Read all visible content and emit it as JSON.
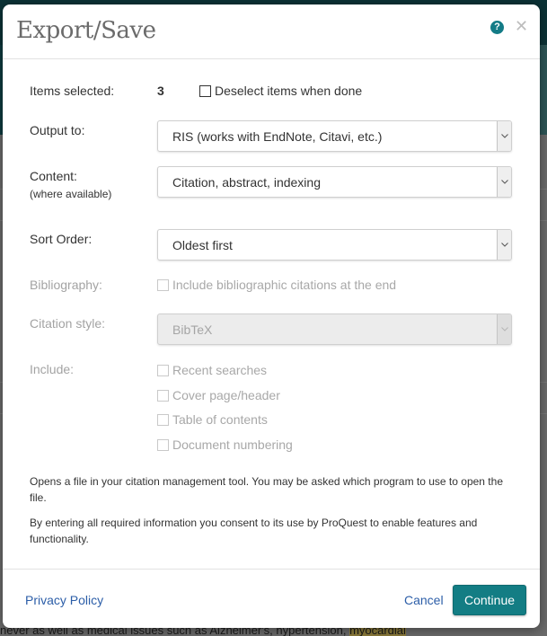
{
  "background": {
    "visible_text_prefix": "never as well as medical issues such as Alzheimer's, hypertension, ",
    "visible_text_highlight": "myocardial"
  },
  "dialog": {
    "title": "Export/Save",
    "help_icon": "question-circle-icon",
    "close_icon": "close-x-icon"
  },
  "form": {
    "items_selected": {
      "label": "Items selected:",
      "count": "3",
      "deselect_label": "Deselect items when done",
      "deselect_checked": false
    },
    "output_to": {
      "label": "Output to:",
      "selected": "RIS (works with EndNote, Citavi, etc.)"
    },
    "content": {
      "label": "Content:",
      "sublabel": "(where available)",
      "selected": "Citation, abstract, indexing"
    },
    "sort_order": {
      "label": "Sort Order:",
      "selected": "Oldest first"
    },
    "bibliography": {
      "label": "Bibliography:",
      "option_label": "Include bibliographic citations at the end",
      "checked": false,
      "disabled": true
    },
    "citation_style": {
      "label": "Citation style:",
      "selected": "BibTeX",
      "disabled": true
    },
    "include": {
      "label": "Include:",
      "options": [
        {
          "label": "Recent searches",
          "checked": false,
          "disabled": true
        },
        {
          "label": "Cover page/header",
          "checked": false,
          "disabled": true
        },
        {
          "label": "Table of contents",
          "checked": false,
          "disabled": true
        },
        {
          "label": "Document numbering",
          "checked": false,
          "disabled": true
        }
      ]
    }
  },
  "info": {
    "description": "Opens a file in your citation management tool. You may be asked which program to use to open the file.",
    "consent": "By entering all required information you consent to its use by ProQuest to enable features and functionality."
  },
  "footer": {
    "privacy_link": "Privacy Policy",
    "cancel_label": "Cancel",
    "continue_label": "Continue"
  },
  "colors": {
    "accent": "#137d84",
    "link": "#2c5ea8",
    "title": "#6b6b6b",
    "disabled_text": "#a3a3a3"
  }
}
